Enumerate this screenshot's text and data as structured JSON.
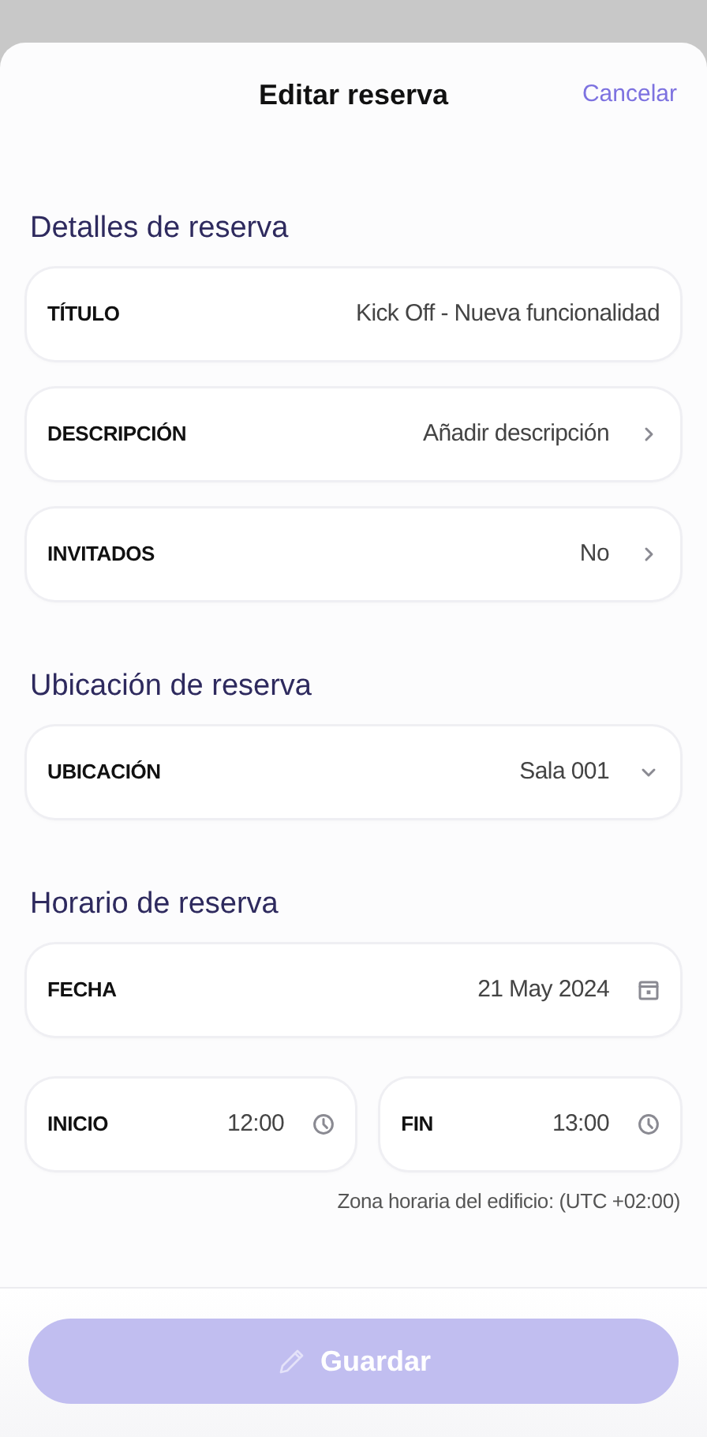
{
  "header": {
    "title": "Editar reserva",
    "cancel": "Cancelar"
  },
  "sections": [
    {
      "title": "Detalles de reserva",
      "rows": [
        [
          {
            "label": "TÍTULO",
            "value": "Kick Off - Nueva funcionalidad",
            "kind": "text"
          }
        ],
        [
          {
            "label": "DESCRIPCIÓN",
            "value": "Añadir descripción",
            "kind": "chevron"
          }
        ],
        [
          {
            "label": "INVITADOS",
            "value": "No",
            "kind": "chevron"
          }
        ]
      ]
    },
    {
      "title": "Ubicación de reserva",
      "rows": [
        [
          {
            "label": "UBICACIÓN",
            "value": "Sala 001",
            "kind": "dropdown"
          }
        ]
      ]
    },
    {
      "title": "Horario de reserva",
      "rows": [
        [
          {
            "label": "FECHA",
            "value": "21 May 2024",
            "kind": "calendar"
          }
        ],
        [
          {
            "label": "INICIO",
            "value": "12:00",
            "kind": "clock"
          },
          {
            "label": "FIN",
            "value": "13:00",
            "kind": "clock"
          }
        ]
      ],
      "note": "Zona horaria del edificio: (UTC +02:00)"
    }
  ],
  "save_button": {
    "label": "Guardar",
    "disabled": true
  }
}
